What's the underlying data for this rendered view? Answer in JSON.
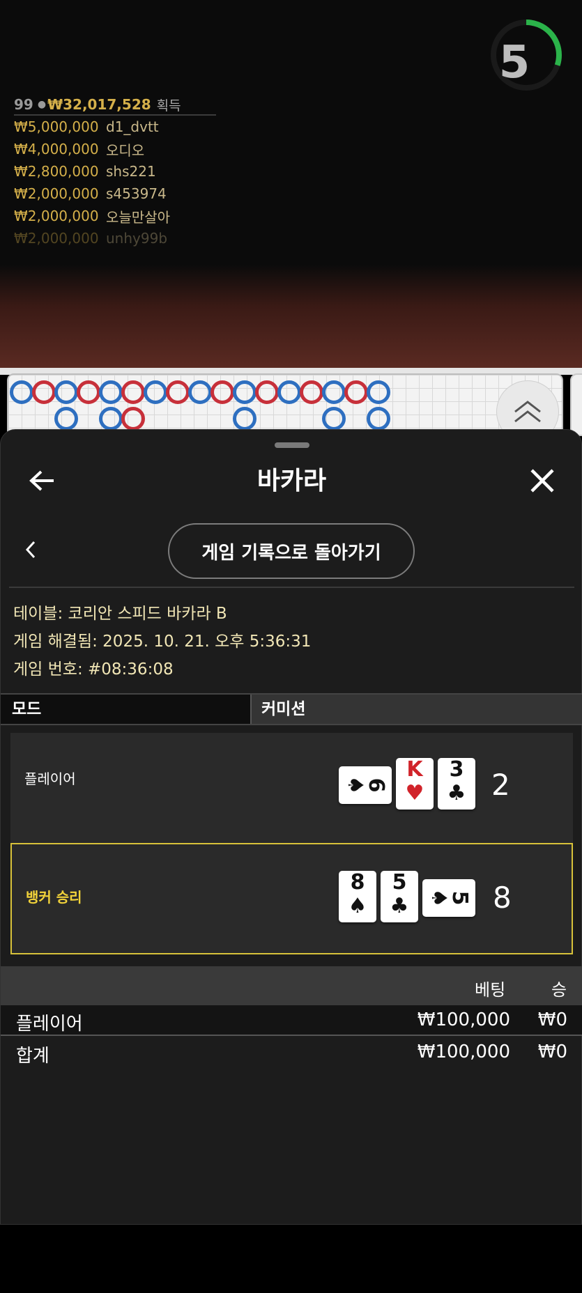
{
  "timer": {
    "value": "5",
    "progress": 0.3,
    "color": "#2bb34a"
  },
  "leaderboard": {
    "players": "99",
    "total": "₩32,017,528",
    "gain_label": "획득",
    "winners": [
      {
        "amount": "₩5,000,000",
        "name": "d1_dvtt"
      },
      {
        "amount": "₩4,000,000",
        "name": "오디오"
      },
      {
        "amount": "₩2,800,000",
        "name": "shs221"
      },
      {
        "amount": "₩2,000,000",
        "name": "s453974"
      },
      {
        "amount": "₩2,000,000",
        "name": "오늘만살아"
      },
      {
        "amount": "₩2,000,000",
        "name": "unhy99b"
      }
    ]
  },
  "road": {
    "colors": {
      "player": "#2e6fc0",
      "banker": "#c7303a"
    },
    "top_row": [
      "P",
      "B",
      "P",
      "B",
      "P",
      "B",
      "P",
      "B",
      "P",
      "B",
      "P",
      "B",
      "P",
      "B",
      "P",
      "B",
      "P"
    ],
    "bottom_row": [
      {
        "col": 2,
        "side": "P"
      },
      {
        "col": 4,
        "side": "P"
      },
      {
        "col": 5,
        "side": "B"
      },
      {
        "col": 10,
        "side": "P"
      },
      {
        "col": 14,
        "side": "P"
      },
      {
        "col": 16,
        "side": "P"
      }
    ]
  },
  "sheet": {
    "title": "바카라",
    "history_button": "게임 기록으로 돌아가기",
    "info": {
      "table": "테이블: 코리안 스피드 바카라 B",
      "resolved": "게임 해결됨: 2025. 10. 21. 오후 5:36:31",
      "game_no": "게임 번호: #08:36:08"
    },
    "mode_label": "모드",
    "mode_value": "커미션"
  },
  "results": {
    "player": {
      "label": "플레이어",
      "score": "2",
      "cards": [
        {
          "rank": "6",
          "suit": "♠",
          "color": "blk",
          "side": true
        },
        {
          "rank": "K",
          "suit": "♥",
          "color": "red",
          "side": false
        },
        {
          "rank": "3",
          "suit": "♣",
          "color": "blk",
          "side": false
        }
      ]
    },
    "banker": {
      "label": "뱅커 승리",
      "score": "8",
      "cards": [
        {
          "rank": "8",
          "suit": "♠",
          "color": "blk",
          "side": false
        },
        {
          "rank": "5",
          "suit": "♣",
          "color": "blk",
          "side": false
        },
        {
          "rank": "5",
          "suit": "♠",
          "color": "blk",
          "side": true
        }
      ]
    }
  },
  "bets": {
    "header_bet": "베팅",
    "header_win": "승",
    "rows": [
      {
        "name": "플레이어",
        "bet": "₩100,000",
        "win": "₩0"
      },
      {
        "name": "합계",
        "bet": "₩100,000",
        "win": "₩0"
      }
    ]
  }
}
